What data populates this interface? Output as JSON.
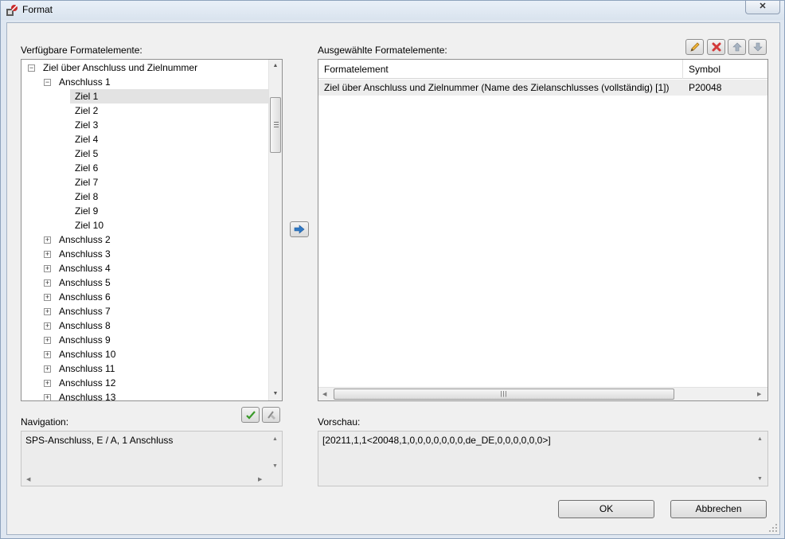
{
  "window": {
    "title": "Format",
    "close_label": "✕"
  },
  "available": {
    "label": "Verfügbare Formatelemente:",
    "tree": [
      {
        "label": "Ziel über Anschluss und Zielnummer",
        "level": 0,
        "expander": "−"
      },
      {
        "label": "Anschluss 1",
        "level": 1,
        "expander": "−"
      },
      {
        "label": "Ziel 1",
        "level": 2,
        "selected": true
      },
      {
        "label": "Ziel 2",
        "level": 2
      },
      {
        "label": "Ziel 3",
        "level": 2
      },
      {
        "label": "Ziel 4",
        "level": 2
      },
      {
        "label": "Ziel 5",
        "level": 2
      },
      {
        "label": "Ziel 6",
        "level": 2
      },
      {
        "label": "Ziel 7",
        "level": 2
      },
      {
        "label": "Ziel 8",
        "level": 2
      },
      {
        "label": "Ziel 9",
        "level": 2
      },
      {
        "label": "Ziel 10",
        "level": 2
      },
      {
        "label": "Anschluss 2",
        "level": 1,
        "expander": "+"
      },
      {
        "label": "Anschluss 3",
        "level": 1,
        "expander": "+"
      },
      {
        "label": "Anschluss 4",
        "level": 1,
        "expander": "+"
      },
      {
        "label": "Anschluss 5",
        "level": 1,
        "expander": "+"
      },
      {
        "label": "Anschluss 6",
        "level": 1,
        "expander": "+"
      },
      {
        "label": "Anschluss 7",
        "level": 1,
        "expander": "+"
      },
      {
        "label": "Anschluss 8",
        "level": 1,
        "expander": "+"
      },
      {
        "label": "Anschluss 9",
        "level": 1,
        "expander": "+"
      },
      {
        "label": "Anschluss 10",
        "level": 1,
        "expander": "+"
      },
      {
        "label": "Anschluss 11",
        "level": 1,
        "expander": "+"
      },
      {
        "label": "Anschluss 12",
        "level": 1,
        "expander": "+"
      },
      {
        "label": "Anschluss 13",
        "level": 1,
        "expander": "+"
      }
    ]
  },
  "selected": {
    "label": "Ausgewählte Formatelemente:",
    "columns": [
      "Formatelement",
      "Symbol"
    ],
    "rows": [
      {
        "element": "Ziel über Anschluss und Zielnummer (Name des Zielanschlusses (vollständig) [1])",
        "symbol": "P20048"
      }
    ],
    "toolbar": [
      "edit-icon",
      "delete-icon",
      "move-up-icon",
      "move-down-icon"
    ]
  },
  "navigation": {
    "label": "Navigation:",
    "value": "SPS-Anschluss, E / A, 1 Anschluss"
  },
  "preview": {
    "label": "Vorschau:",
    "value": "[20211,1,1<20048,1,0,0,0,0,0,0,0,de_DE,0,0,0,0,0,0>]"
  },
  "buttons": {
    "ok": "OK",
    "cancel": "Abbrechen"
  },
  "colors": {
    "accent": "#2f78c4",
    "delete": "#d33a3a",
    "selection": "#e3e3e3"
  }
}
